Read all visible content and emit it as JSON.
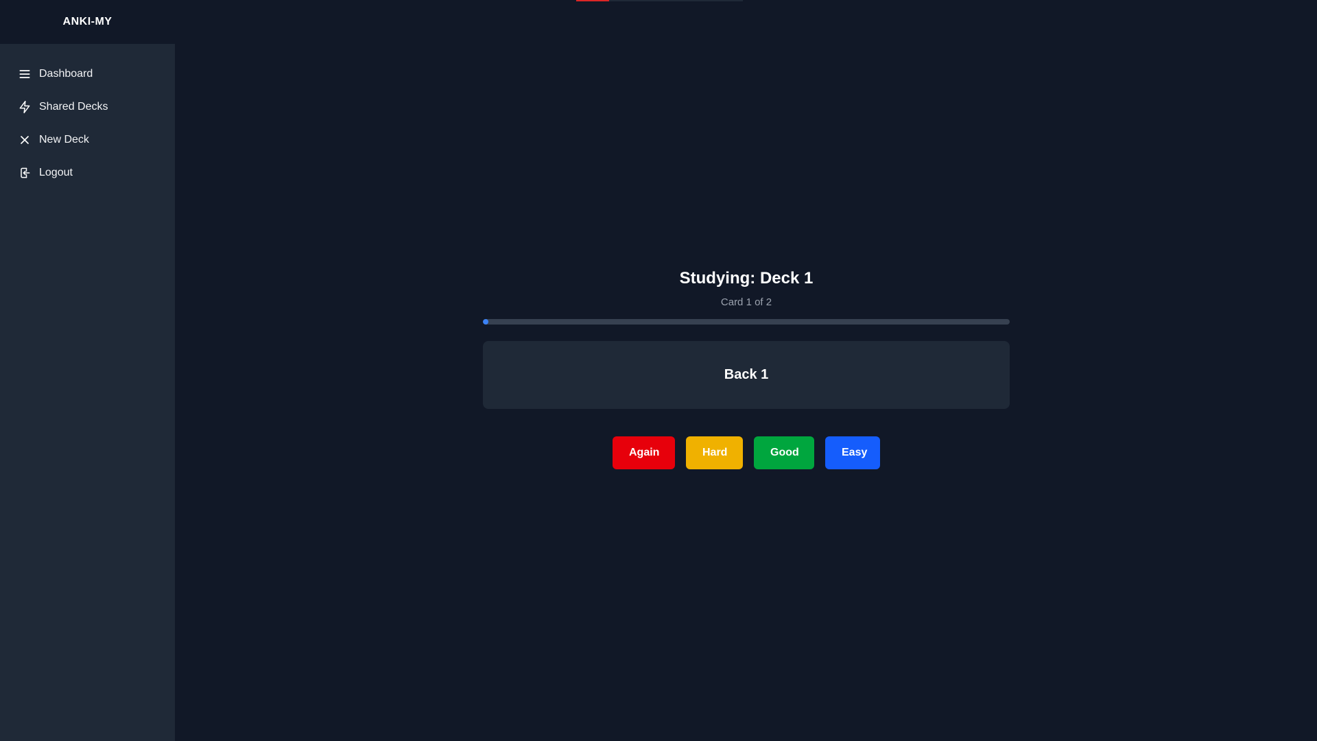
{
  "app": {
    "brand": "ANKI-MY"
  },
  "sidebar": {
    "items": [
      {
        "label": "Dashboard",
        "icon": "menu-icon"
      },
      {
        "label": "Shared Decks",
        "icon": "lightning-icon"
      },
      {
        "label": "New Deck",
        "icon": "close-icon"
      },
      {
        "label": "Logout",
        "icon": "logout-icon"
      }
    ]
  },
  "study": {
    "title": "Studying: Deck 1",
    "subtitle": "Card 1 of 2",
    "progress_fraction": 0.0,
    "card_text": "Back 1"
  },
  "answers": {
    "again": "Again",
    "hard": "Hard",
    "good": "Good",
    "easy": "Easy"
  },
  "colors": {
    "background": "#111827",
    "sidebar": "#1f2937",
    "progress": "#3b82f6",
    "again": "#e7000b",
    "hard": "#f0b100",
    "good": "#00a63e",
    "easy": "#155dfc"
  }
}
